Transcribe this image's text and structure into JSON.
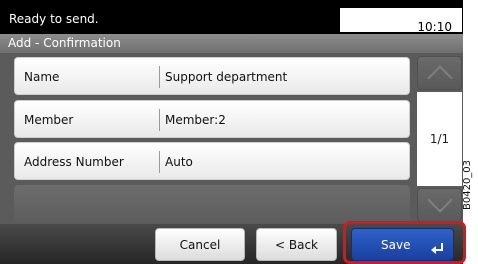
{
  "status": {
    "message": "Ready to send.",
    "time": "10:10"
  },
  "screen": {
    "title": "Add - Confirmation"
  },
  "rows": [
    {
      "label": "Name",
      "value": "Support department"
    },
    {
      "label": "Member",
      "value": "Member:2"
    },
    {
      "label": "Address Number",
      "value": "Auto"
    }
  ],
  "pagination": {
    "indicator": "1/1"
  },
  "buttons": {
    "cancel": "Cancel",
    "back": "< Back",
    "save": "Save"
  },
  "figure_id": "B0420_03",
  "colors": {
    "highlight": "#d8161e",
    "save": "#1f4db8"
  }
}
